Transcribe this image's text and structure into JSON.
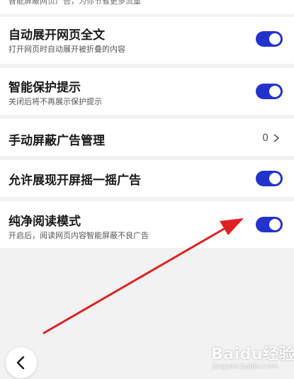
{
  "top_cut_text": "智能屏蔽网页广告，为你节省更多流量",
  "settings": [
    {
      "title": "自动展开网页全文",
      "subtitle": "打开网页时自动展开被折叠的内容",
      "control": "toggle",
      "on": true
    },
    {
      "title": "智能保护提示",
      "subtitle": "关闭后将不再展示保护提示",
      "control": "toggle",
      "on": true
    },
    {
      "title": "手动屏蔽广告管理",
      "control": "count",
      "count": "0"
    },
    {
      "title": "允许展现开屏摇一摇广告",
      "control": "toggle",
      "on": true
    },
    {
      "title": "纯净阅读模式",
      "subtitle": "开启后，阅读网页内容智能屏蔽不良广告",
      "control": "toggle",
      "on": true
    }
  ],
  "colors": {
    "toggle_on": "#2233cc",
    "annotation_arrow": "#e02020",
    "background": "#f2f2f2"
  },
  "watermark": {
    "main": "Baidu经验",
    "sub": "jingyan.baidu.com"
  },
  "icons": {
    "back": "chevron-left-icon",
    "row_arrow": "chevron-right-icon"
  }
}
